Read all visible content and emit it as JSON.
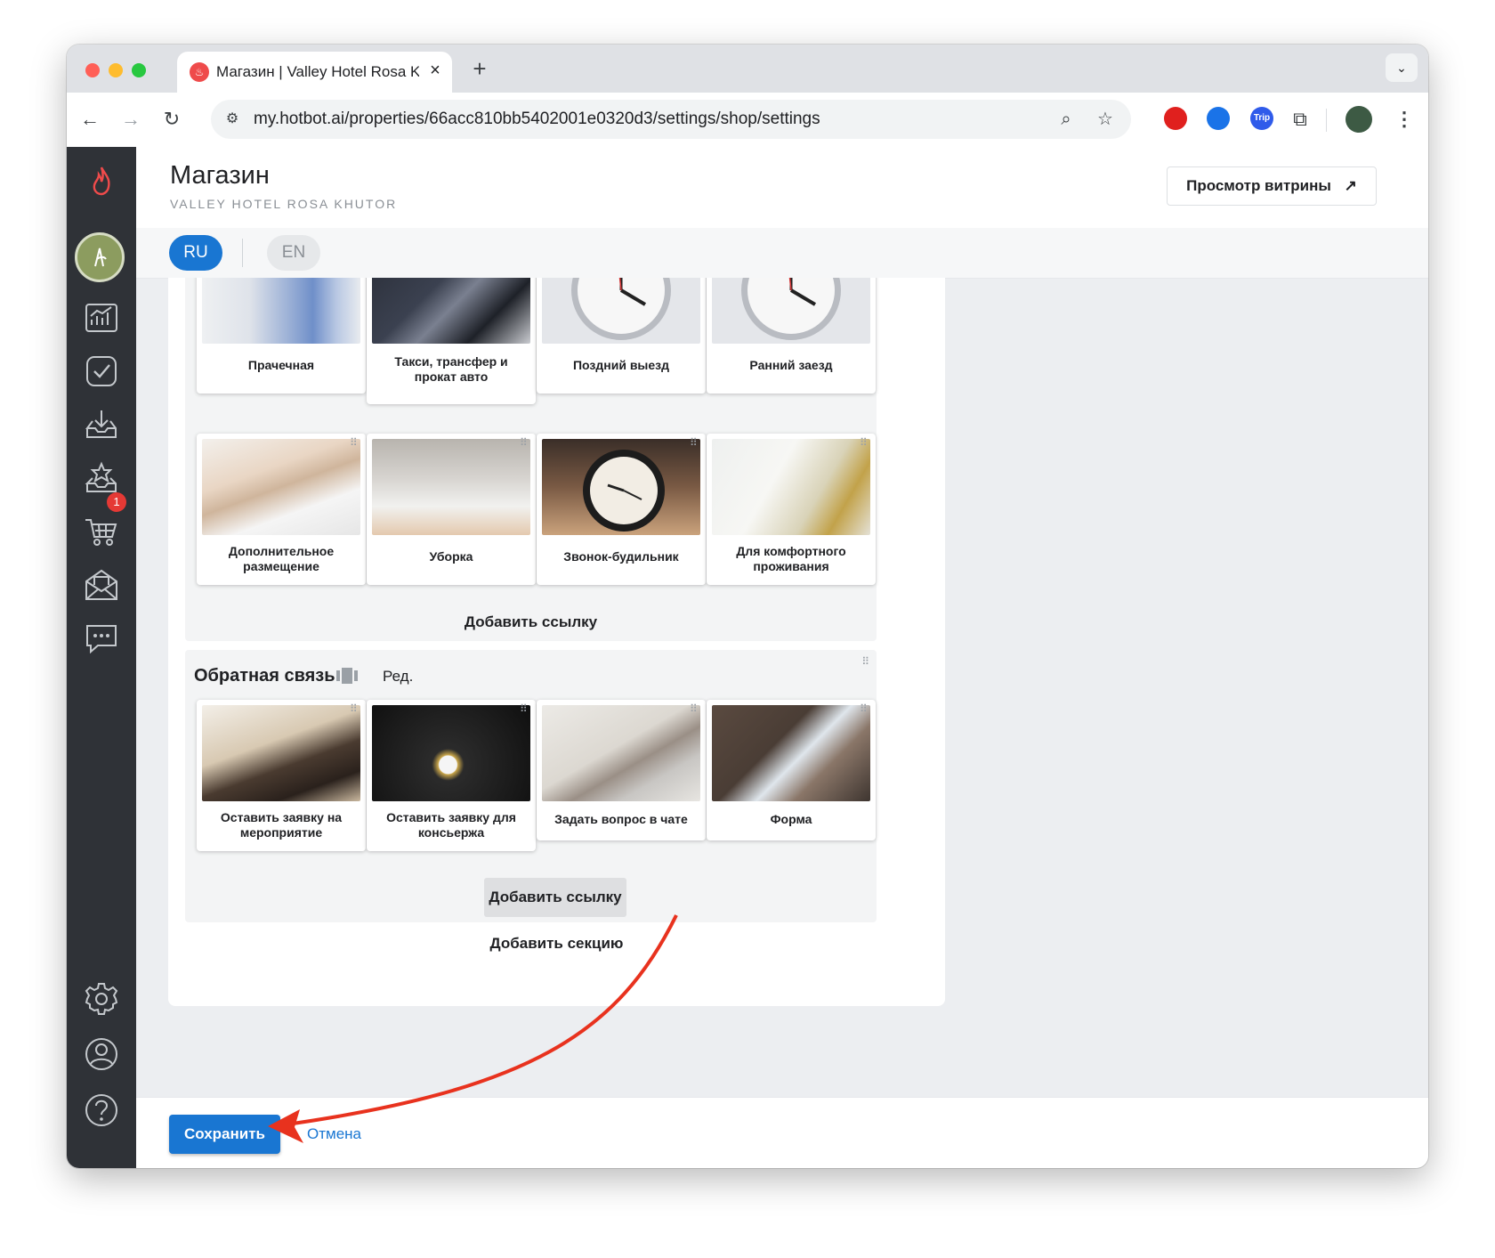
{
  "browser": {
    "tab_title": "Магазин | Valley Hotel Rosa K",
    "url": "my.hotbot.ai/properties/66acc810bb5402001e0320d3/settings/shop/settings",
    "icons": [
      "back-arrow-icon",
      "forward-arrow-icon",
      "reload-icon",
      "site-settings-icon",
      "zoom-icon",
      "bookmark-star-icon",
      "extensions-icon",
      "kebab-menu-icon"
    ],
    "extensions": [
      {
        "name": "opera-adblock-icon",
        "color": "#e0201e",
        "text": ""
      },
      {
        "name": "tag-extension-icon",
        "color": "#1a73e8",
        "text": ""
      },
      {
        "name": "trip-extension-icon",
        "color": "#2f5bea",
        "text": "Trip"
      }
    ]
  },
  "sidebar": {
    "items": [
      "analytics-icon",
      "tasks-icon",
      "inbox-download-icon",
      "reviews-star-icon",
      "shop-cart-icon",
      "mail-campaign-icon",
      "chat-icon",
      "settings-gear-icon",
      "profile-icon",
      "help-icon"
    ],
    "badge_count": "1"
  },
  "header": {
    "title": "Магазин",
    "subtitle": "VALLEY HOTEL ROSA KHUTOR",
    "storefront_button": "Просмотр витрины",
    "storefront_arrow": "↗"
  },
  "lang": {
    "ru": "RU",
    "en": "EN"
  },
  "section_services": {
    "tiles": [
      {
        "label": "Прачечная"
      },
      {
        "label": "Такси, трансфер и прокат авто"
      },
      {
        "label": "Поздний выезд"
      },
      {
        "label": "Ранний заезд"
      },
      {
        "label": "Дополнительное размещение"
      },
      {
        "label": "Уборка"
      },
      {
        "label": "Звонок-будильник"
      },
      {
        "label": "Для комфортного проживания"
      }
    ],
    "add_link": "Добавить ссылку"
  },
  "section_feedback": {
    "title": "Обратная связь",
    "edit": "Ред.",
    "tiles": [
      {
        "label": "Оставить заявку на мероприятие"
      },
      {
        "label": "Оставить заявку для консьержа"
      },
      {
        "label": "Задать вопрос в чате"
      },
      {
        "label": "Форма"
      }
    ],
    "add_link": "Добавить ссылку"
  },
  "add_section": "Добавить секцию",
  "footer": {
    "save": "Сохранить",
    "cancel": "Отмена"
  },
  "colors": {
    "accent": "#1976d2",
    "sidebar": "#2f3237",
    "annotation_arrow": "#e8321e",
    "badge": "#e53935"
  }
}
